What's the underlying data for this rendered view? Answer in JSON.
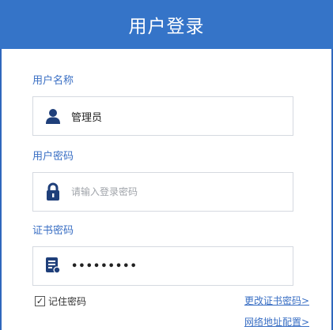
{
  "header": {
    "title": "用户登录"
  },
  "username": {
    "label": "用户名称",
    "value": "管理员",
    "icon": "user-icon"
  },
  "password": {
    "label": "用户密码",
    "placeholder": "请输入登录密码",
    "icon": "lock-icon"
  },
  "cert_password": {
    "label": "证书密码",
    "masked_value": "•••••••••",
    "icon": "certificate-icon"
  },
  "remember": {
    "label": "记住密码",
    "checked": true,
    "check_mark": "✓"
  },
  "links": {
    "change_cert_password": "更改证书密码>",
    "network_config": "网络地址配置>"
  },
  "colors": {
    "header_bg": "#3574c8",
    "label": "#3a6fc4",
    "icon": "#1f3f7a"
  }
}
